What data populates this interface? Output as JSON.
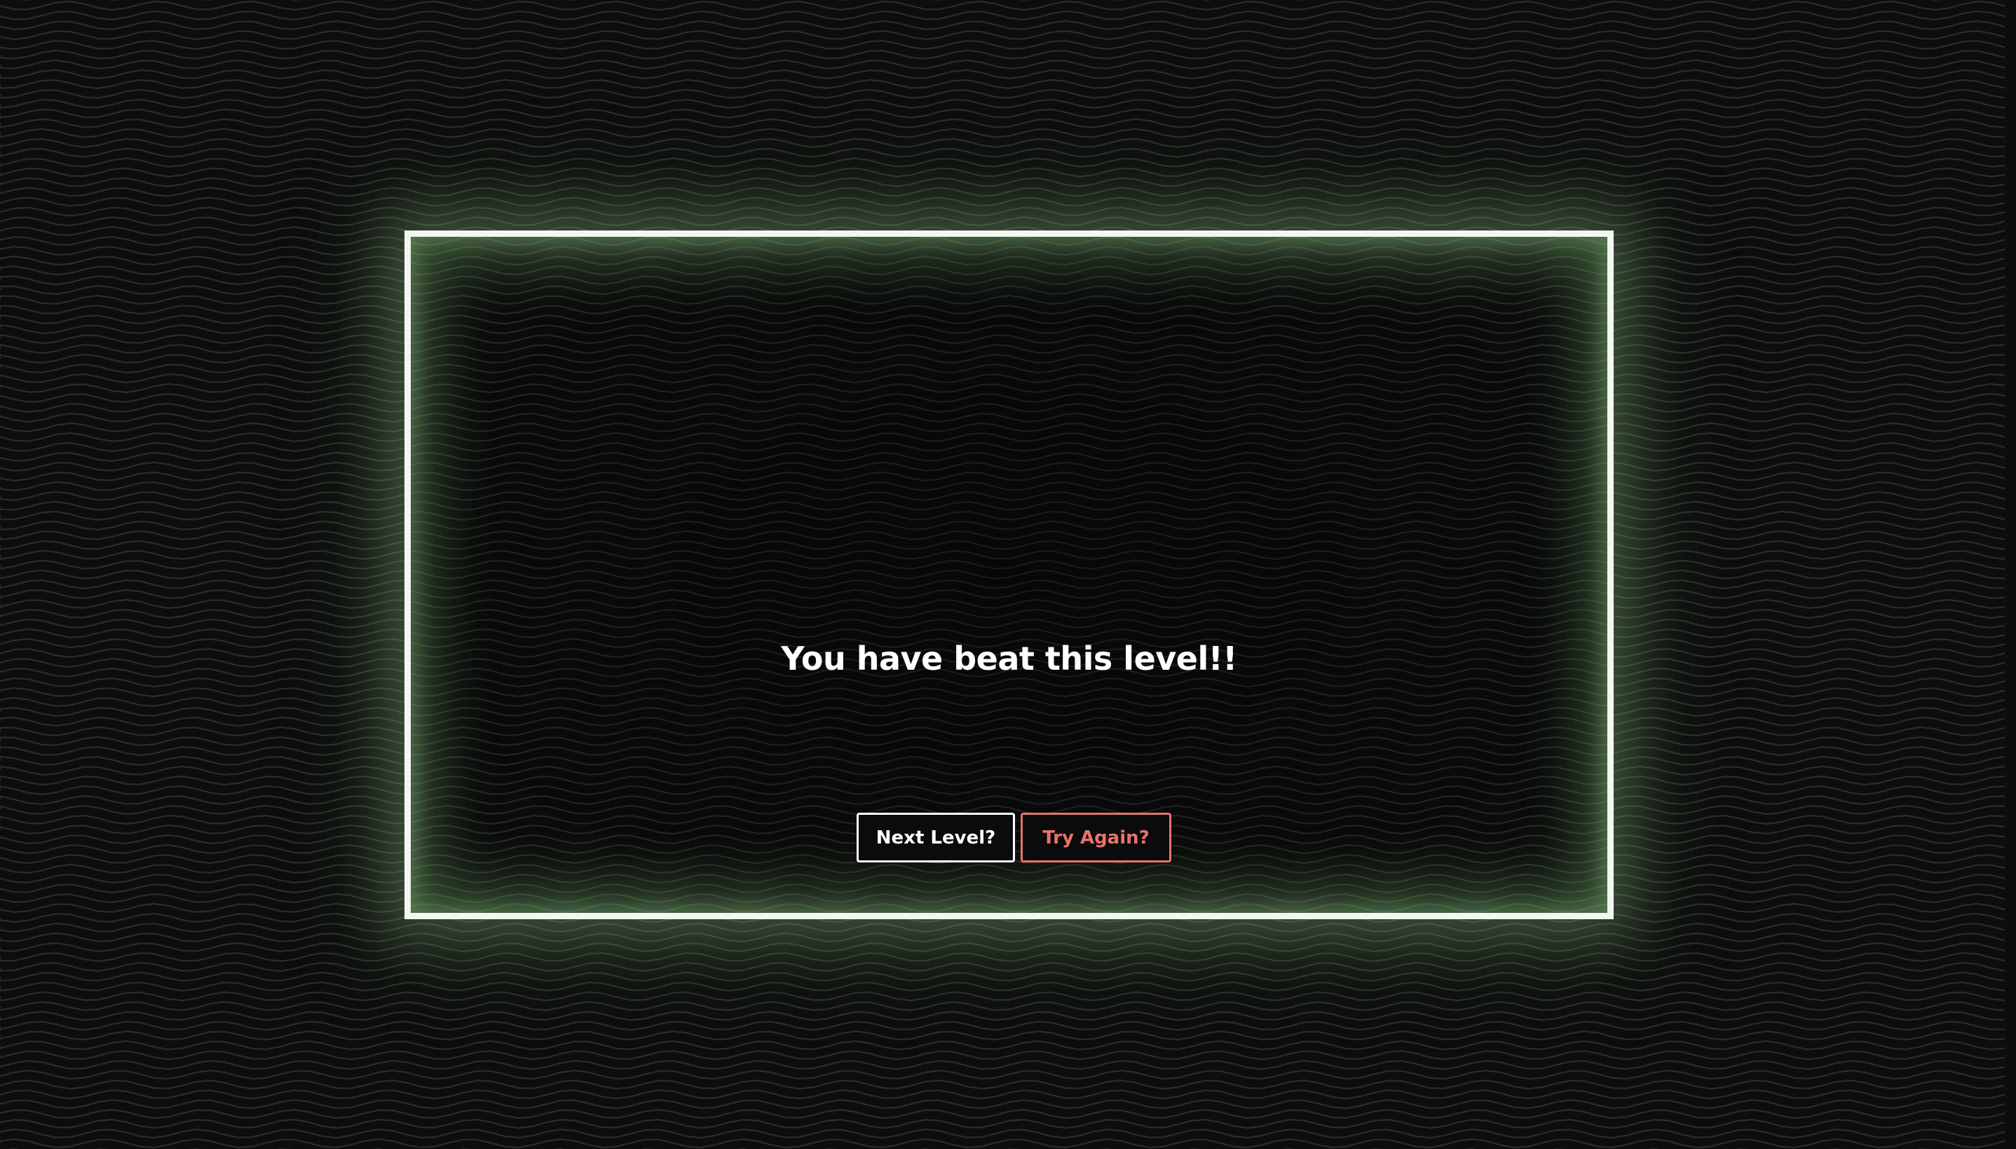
{
  "game": {
    "message": "You have beat this level!!",
    "next_level_label": "Next Level?",
    "try_again_label": "Try Again?"
  },
  "colors": {
    "background": "#0c0d0c",
    "wave_line": "#2a2d2a",
    "panel_border": "#f4f6f2",
    "panel_glow": "#8cbe82",
    "text": "#ffffff",
    "try_again_accent": "#e8736b"
  }
}
